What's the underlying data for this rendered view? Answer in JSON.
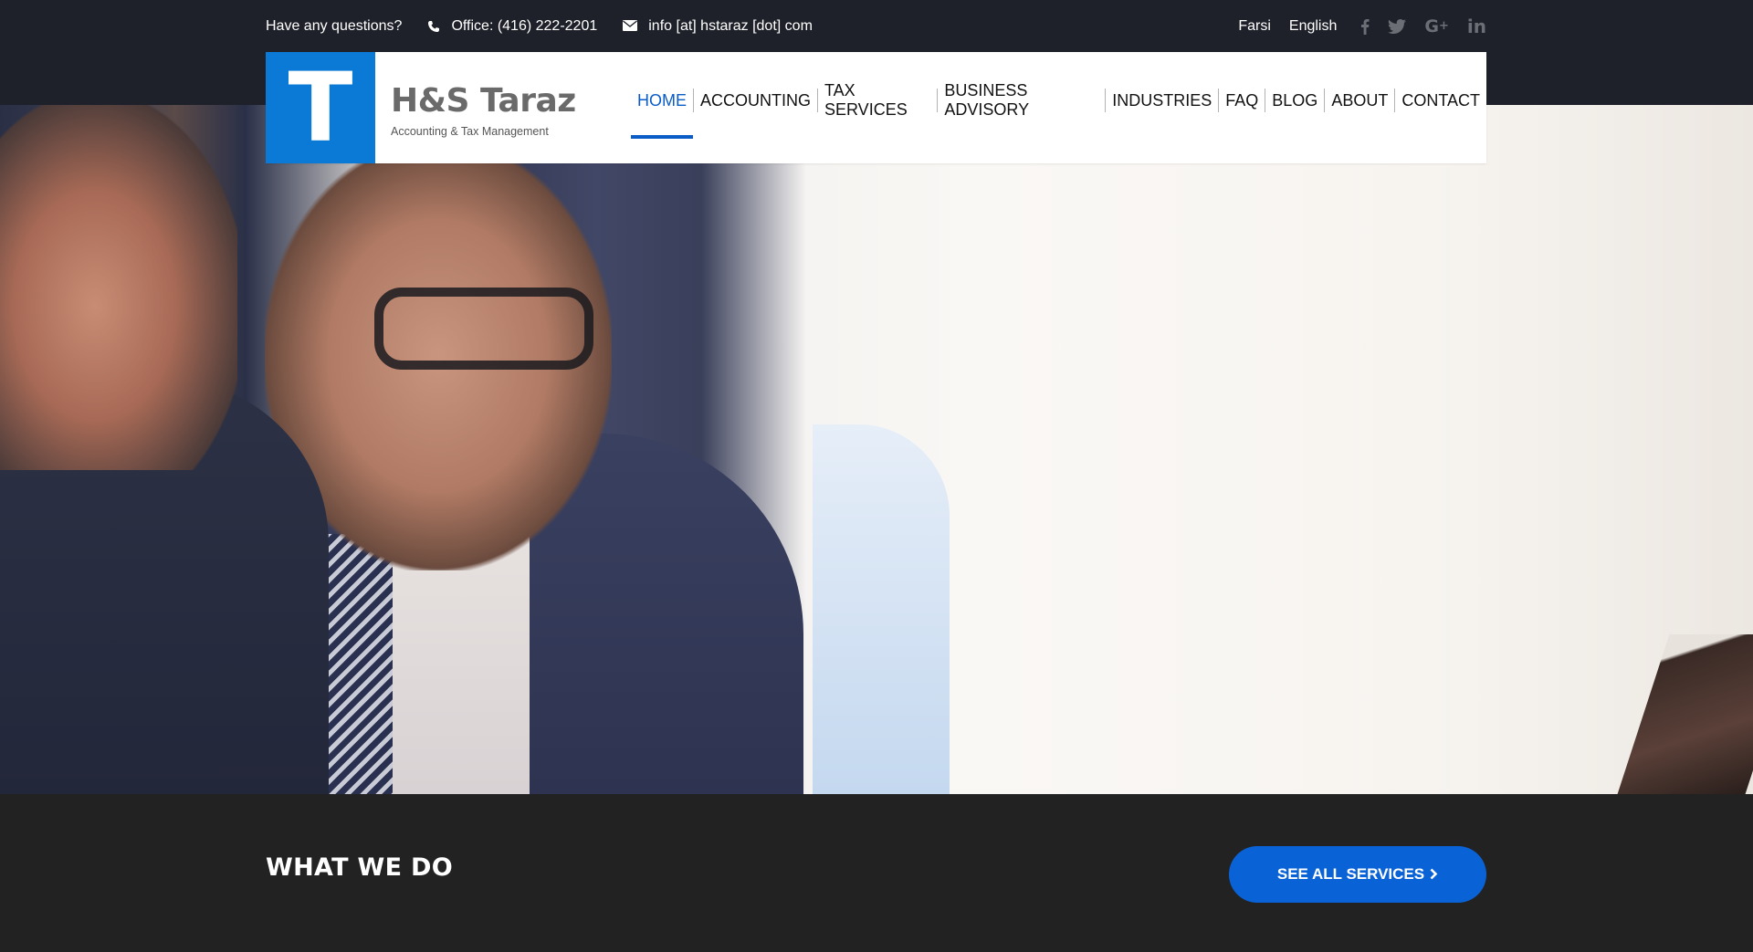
{
  "topbar": {
    "question": "Have any questions?",
    "phone": "Office: (416) 222-2201",
    "email": "info [at] hstaraz [dot] com",
    "languages": [
      "Farsi",
      "English"
    ],
    "socials": [
      {
        "name": "facebook",
        "glyph": "f"
      },
      {
        "name": "twitter",
        "glyph": "🐦"
      },
      {
        "name": "google-plus",
        "glyph": "G+"
      },
      {
        "name": "linkedin",
        "glyph": "in"
      }
    ]
  },
  "logo": {
    "letter": "T",
    "title": "H&S Taraz",
    "subtitle": "Accounting & Tax Management"
  },
  "nav": {
    "items": [
      {
        "label": "HOME",
        "active": true
      },
      {
        "label": "ACCOUNTING"
      },
      {
        "label": "TAX SERVICES"
      },
      {
        "label": "BUSINESS ADVISORY"
      },
      {
        "label": "INDUSTRIES"
      },
      {
        "label": "FAQ"
      },
      {
        "label": "BLOG"
      },
      {
        "label": "ABOUT"
      },
      {
        "label": "CONTACT"
      }
    ]
  },
  "section": {
    "title": "WHAT WE DO",
    "button_label": "SEE ALL SERVICES",
    "button_chevron": "›"
  },
  "colors": {
    "topbar_bg": "#1e212a",
    "brand_blue": "#0a7ad6",
    "nav_active": "#0a5cc7",
    "button_blue": "#0a63d6",
    "section_bg": "#222222"
  }
}
